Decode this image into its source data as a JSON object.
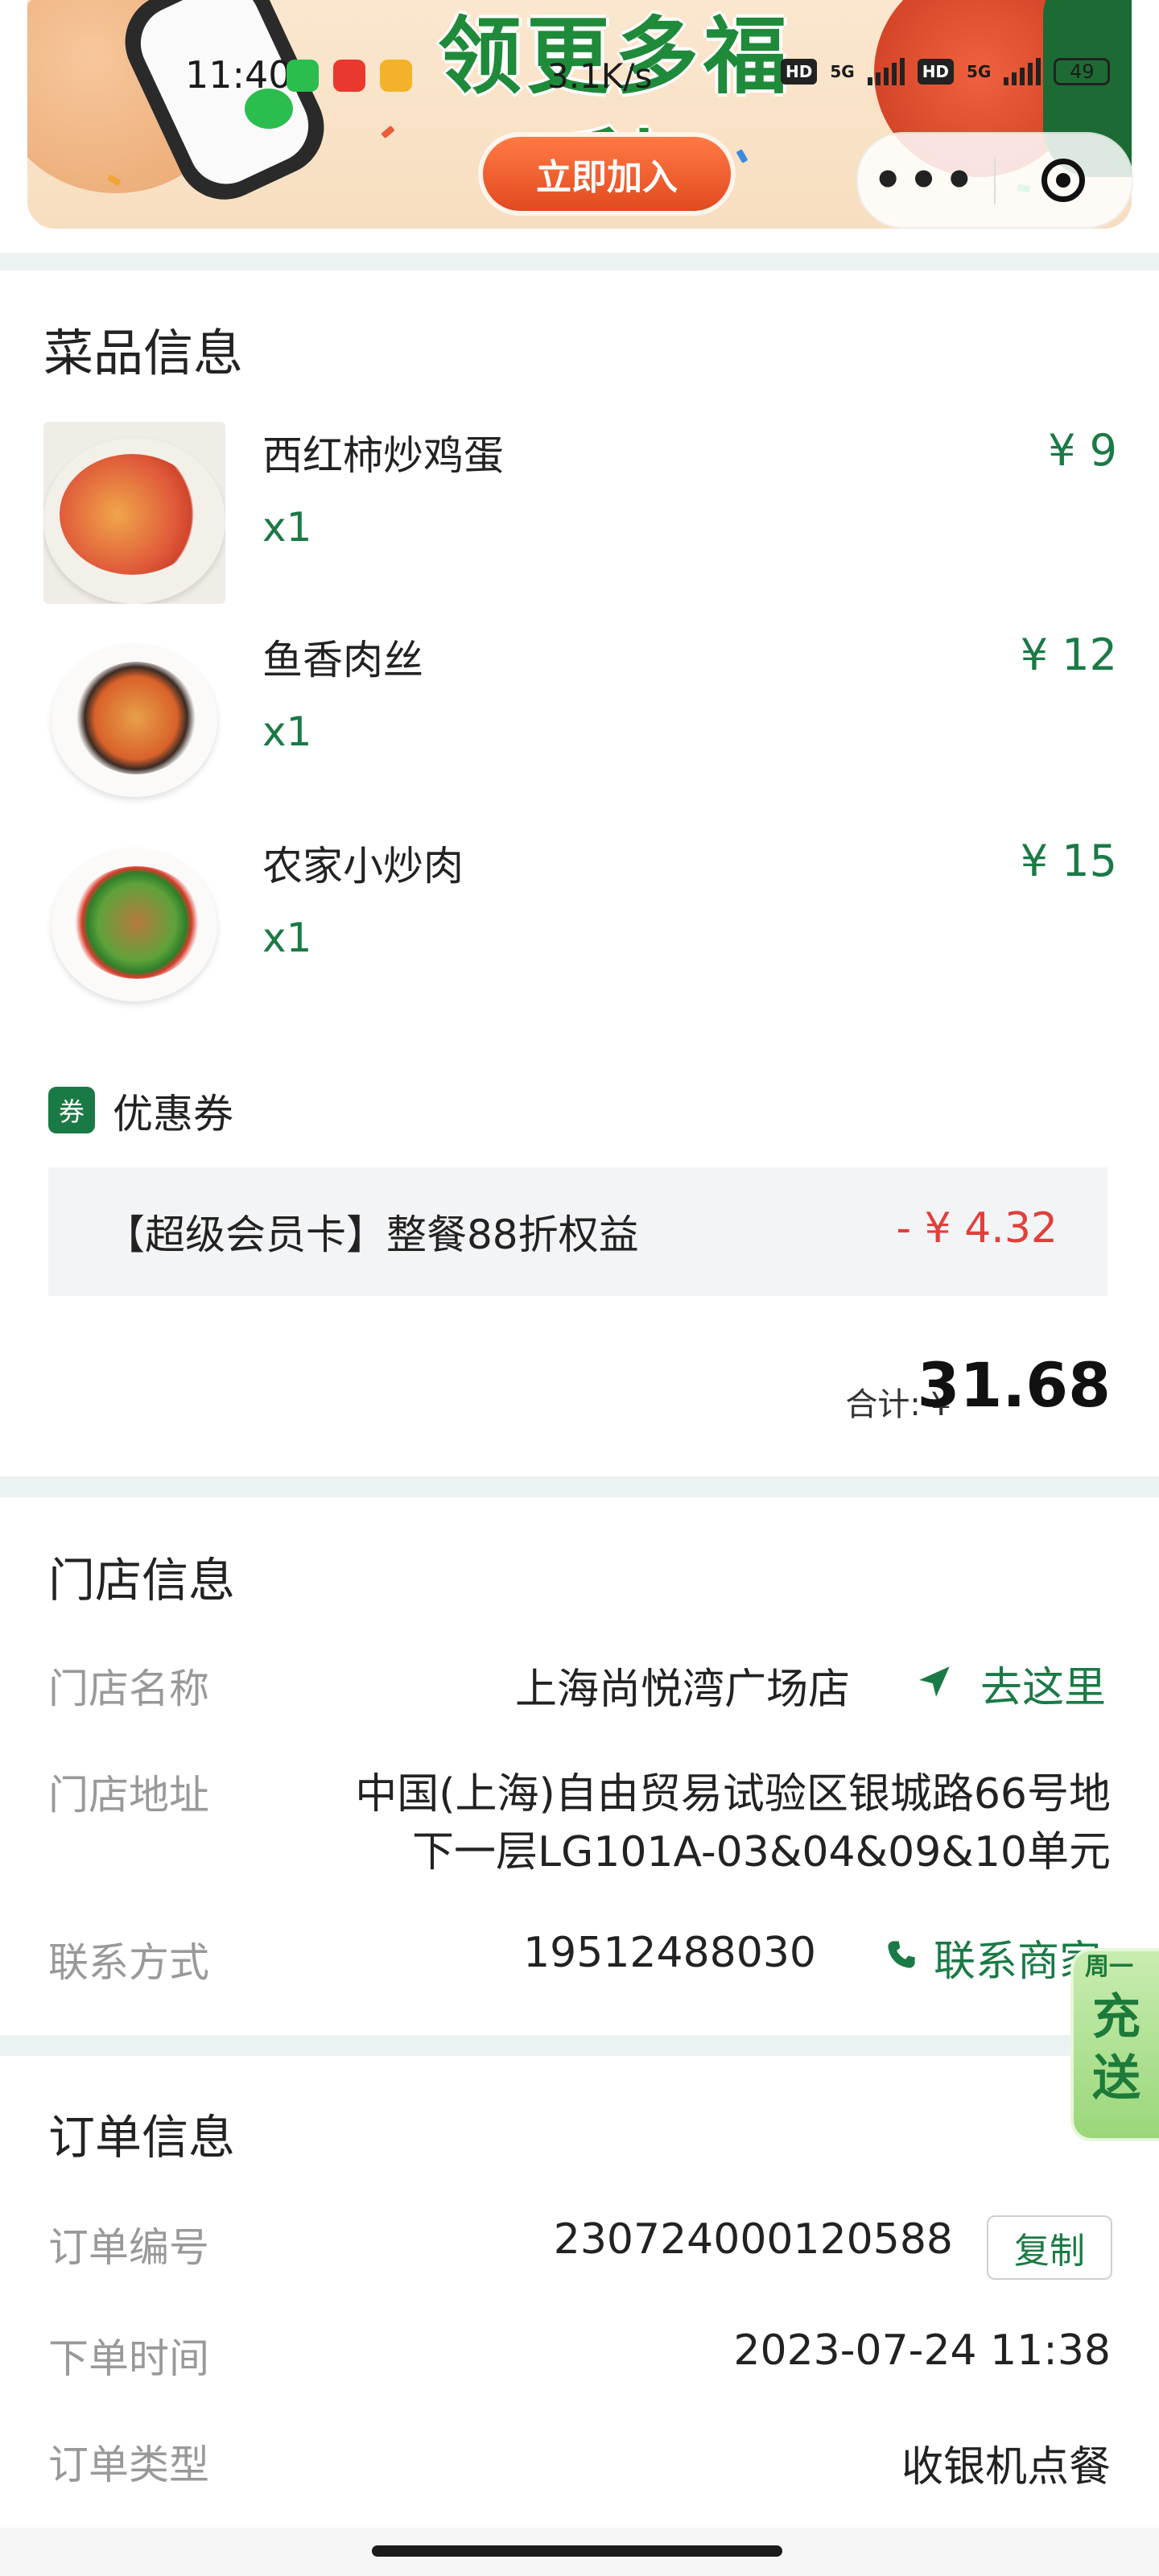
{
  "banner": {
    "title": "领更多福利",
    "join_button": "立即加入"
  },
  "status_bar": {
    "time": "11:40",
    "network_speed": "3.1K/s",
    "sig1": "5G",
    "sig2": "5G",
    "hd1": "HD",
    "hd2": "HD",
    "battery": "49"
  },
  "capsule": {
    "more": "•••"
  },
  "dishes": {
    "section_title": "菜品信息",
    "items": [
      {
        "name": "西红柿炒鸡蛋",
        "qty": "x1",
        "price": "¥ 9"
      },
      {
        "name": "鱼香肉丝",
        "qty": "x1",
        "price": "¥ 12"
      },
      {
        "name": "农家小炒肉",
        "qty": "x1",
        "price": "¥ 15"
      }
    ]
  },
  "coupon": {
    "icon_text": "券",
    "title": "优惠券",
    "item_text": "【超级会员卡】整餐88折权益",
    "amount": "- ¥ 4.32"
  },
  "total": {
    "label": "合计: ¥",
    "value": "31.68"
  },
  "store": {
    "section_title": "门店信息",
    "name_label": "门店名称",
    "name_value": "上海尚悦湾广场店",
    "navigate": "去这里",
    "address_label": "门店地址",
    "address_line1": "中国(上海)自由贸易试验区银城路66号地",
    "address_line2": "下一层LG101A-03&04&09&10单元",
    "contact_label": "联系方式",
    "phone": "19512488030",
    "contact_link": "联系商家"
  },
  "order": {
    "section_title": "订单信息",
    "number_label": "订单编号",
    "number_value": "230724000120588",
    "copy": "复制",
    "time_label": "下单时间",
    "time_value": "2023-07-24 11:38",
    "type_label": "订单类型",
    "type_value": "收银机点餐"
  },
  "float_badge": {
    "top": "周一",
    "line1": "充",
    "line2": "送"
  },
  "colors": {
    "accent_green": "#1a7a45",
    "discount_red": "#e0403c",
    "label_gray": "#999999",
    "separator": "#ebf3f2"
  }
}
